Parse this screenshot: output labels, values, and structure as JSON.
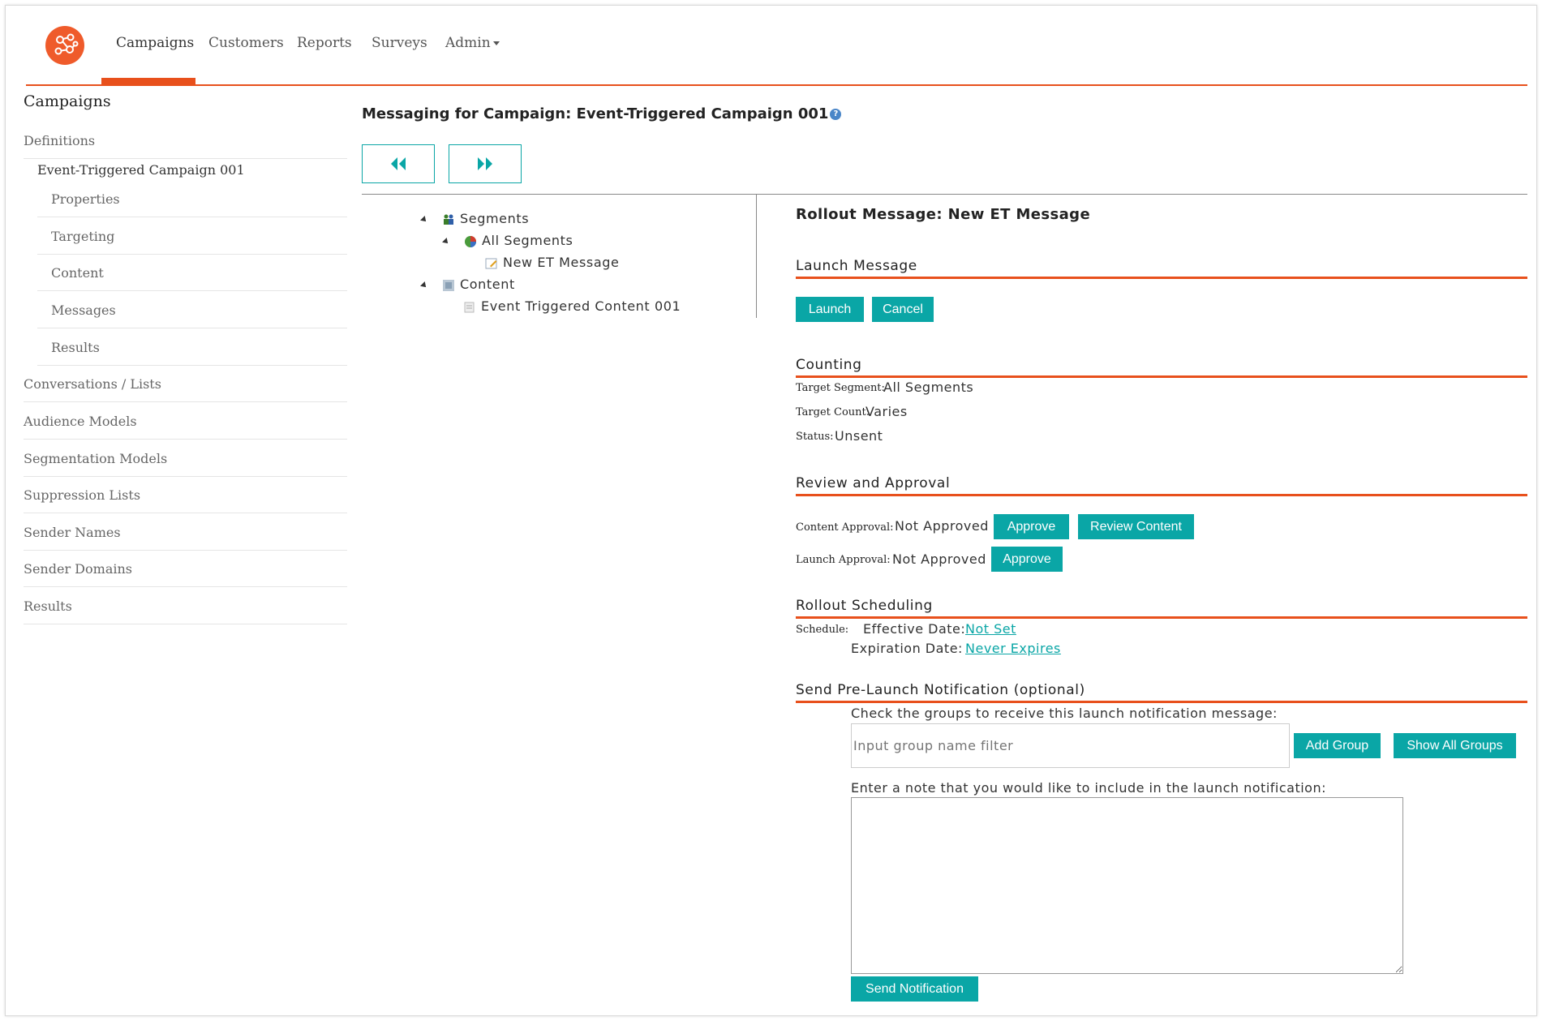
{
  "nav": {
    "items": [
      {
        "label": "Campaigns",
        "active": true
      },
      {
        "label": "Customers"
      },
      {
        "label": "Reports"
      },
      {
        "label": "Surveys"
      },
      {
        "label": "Admin"
      }
    ],
    "accent_color": "#e8501c"
  },
  "sidebar": {
    "title": "Campaigns",
    "definitions": "Definitions",
    "campaign": "Event-Triggered Campaign 001",
    "sub_items": [
      "Properties",
      "Targeting",
      "Content",
      "Messages",
      "Results"
    ],
    "items": [
      "Conversations / Lists",
      "Audience Models",
      "Segmentation Models",
      "Suppression Lists",
      "Sender Names",
      "Sender Domains",
      "Results"
    ]
  },
  "main": {
    "title": "Messaging for Campaign: Event-Triggered Campaign 001",
    "prev_icon": "double-chevron-left-icon",
    "next_icon": "double-chevron-right-icon"
  },
  "tree": {
    "segments": "Segments",
    "all_segments": "All Segments",
    "message": "New ET Message",
    "content": "Content",
    "content_item": "Event Triggered Content 001"
  },
  "panel": {
    "title": "Rollout Message: New ET Message",
    "launch": {
      "heading": "Launch Message",
      "launch_btn": "Launch",
      "cancel_btn": "Cancel"
    },
    "counting": {
      "heading": "Counting",
      "target_segment_label": "Target Segment:",
      "target_segment": "All Segments",
      "target_count_label": "Target Count:",
      "target_count": "Varies",
      "status_label": "Status:",
      "status": "Unsent"
    },
    "review": {
      "heading": "Review and Approval",
      "content_label": "Content Approval:",
      "content_status": "Not Approved",
      "approve_btn": "Approve",
      "review_btn": "Review Content",
      "launch_label": "Launch Approval:",
      "launch_status": "Not Approved",
      "approve_btn2": "Approve"
    },
    "scheduling": {
      "heading": "Rollout Scheduling",
      "schedule_label": "Schedule:",
      "effective_label": "Effective Date:",
      "effective_value": "Not Set",
      "expiration_label": "Expiration Date:",
      "expiration_value": "Never Expires"
    },
    "notification": {
      "heading": "Send Pre-Launch Notification (optional)",
      "groups_prompt": "Check the groups to receive this launch notification message:",
      "filter_placeholder": "Input group name filter",
      "add_group_btn": "Add Group",
      "show_groups_btn": "Show All Groups",
      "note_prompt": "Enter a note that you would like to include in the launch notification:",
      "send_btn": "Send Notification"
    },
    "button_color": "#0aa6a6"
  }
}
